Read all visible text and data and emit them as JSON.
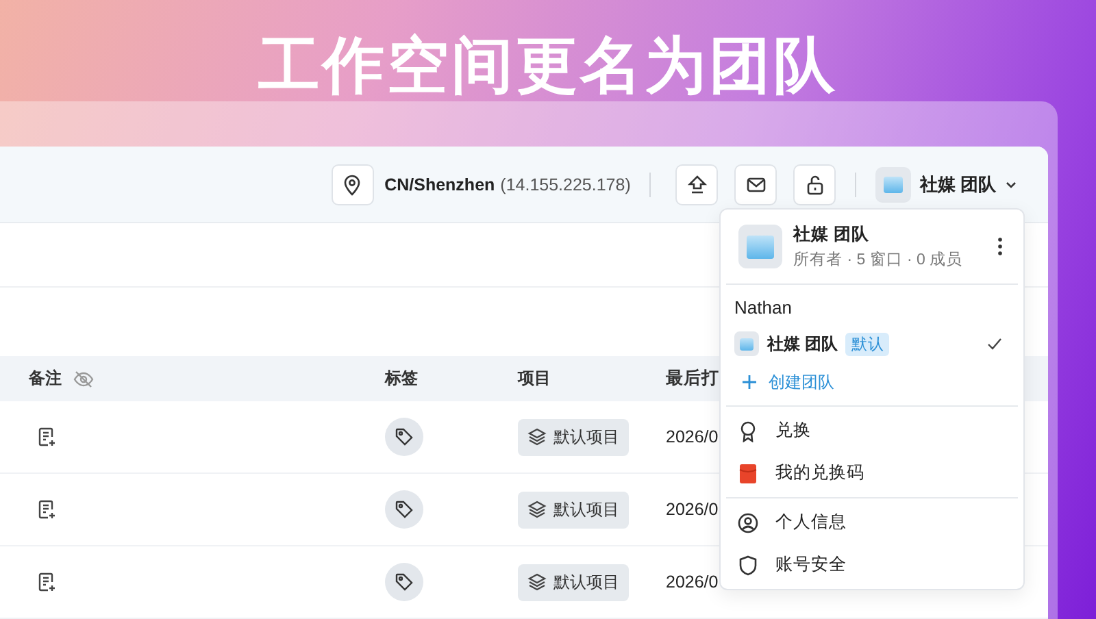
{
  "title": "工作空间更名为团队",
  "topbar": {
    "location": "CN/Shenzhen",
    "ip": "(14.155.225.178)",
    "team": "社媒 团队"
  },
  "table": {
    "columns": [
      {
        "label": "备注"
      },
      {
        "label": "标签"
      },
      {
        "label": "项目"
      },
      {
        "label": "最后打"
      }
    ],
    "rows": [
      {
        "project": "默认项目",
        "date": "2026/0"
      },
      {
        "project": "默认项目",
        "date": "2026/0"
      },
      {
        "project": "默认项目",
        "date": "2026/0"
      }
    ]
  },
  "menu": {
    "team_name": "社媒 团队",
    "team_meta": "所有者 · 5 窗口 · 0 成员",
    "owner": "Nathan",
    "teams": [
      {
        "name": "社媒 团队",
        "badge": "默认",
        "selected": true
      }
    ],
    "create": "创建团队",
    "groups": [
      [
        {
          "label": "兑换"
        },
        {
          "label": "我的兑换码"
        }
      ],
      [
        {
          "label": "个人信息"
        },
        {
          "label": "账号安全"
        }
      ]
    ]
  }
}
